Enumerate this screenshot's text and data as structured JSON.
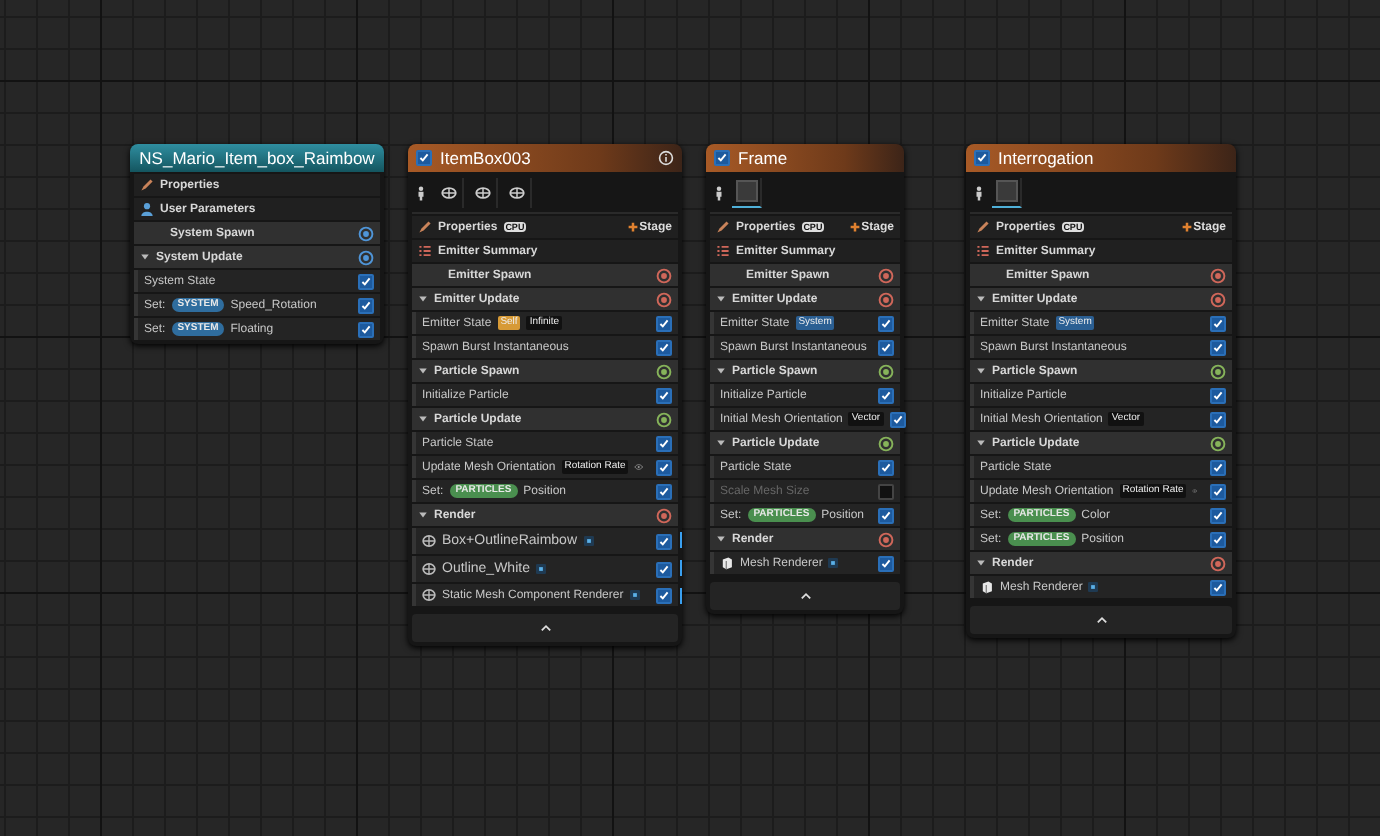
{
  "nodes": [
    {
      "kind": "system",
      "title": "NS_Mario_Item_box_Raimbow",
      "rows": [
        {
          "kind": "properties",
          "label": "Properties"
        },
        {
          "kind": "user_parameters",
          "label": "User Parameters"
        },
        {
          "kind": "group",
          "label": "System Spawn",
          "expandable": false,
          "color": "#4f95d8"
        },
        {
          "kind": "group",
          "label": "System Update",
          "expandable": true,
          "expanded": true,
          "color": "#4f95d8"
        },
        {
          "kind": "module",
          "checked": true,
          "parts": [
            {
              "kind": "text",
              "text": "System State"
            }
          ]
        },
        {
          "kind": "module",
          "checked": true,
          "parts": [
            {
              "kind": "text",
              "text": "Set:"
            },
            {
              "kind": "pill",
              "text": "SYSTEM",
              "color": "#2f6d9e"
            },
            {
              "kind": "text",
              "text": "Speed_Rotation"
            }
          ]
        },
        {
          "kind": "module",
          "checked": true,
          "parts": [
            {
              "kind": "text",
              "text": "Set:"
            },
            {
              "kind": "pill",
              "text": "SYSTEM",
              "color": "#2f6d9e"
            },
            {
              "kind": "text",
              "text": "Floating"
            }
          ]
        }
      ]
    },
    {
      "kind": "emitter",
      "title": "ItemBox003",
      "enabled": true,
      "info": true,
      "collapsible": true,
      "thumbnails": [
        {
          "selected": false
        },
        {
          "selected": false
        },
        {
          "selected": false
        }
      ],
      "rows": [
        {
          "kind": "properties",
          "label": "Properties",
          "sim_target": "CPU",
          "stage_button": "Stage"
        },
        {
          "kind": "summary",
          "label": "Emitter Summary"
        },
        {
          "kind": "group",
          "label": "Emitter Spawn",
          "expandable": false,
          "color": "#d0675a"
        },
        {
          "kind": "group",
          "label": "Emitter Update",
          "expandable": true,
          "expanded": true,
          "color": "#d0675a"
        },
        {
          "kind": "module",
          "checked": true,
          "parts": [
            {
              "kind": "text",
              "text": "Emitter State"
            },
            {
              "kind": "tag",
              "text": "Self",
              "color": "#d79a36"
            },
            {
              "kind": "tag",
              "text": "Infinite",
              "color": "#111111"
            }
          ]
        },
        {
          "kind": "module",
          "checked": true,
          "parts": [
            {
              "kind": "text",
              "text": "Spawn Burst Instantaneous"
            }
          ]
        },
        {
          "kind": "group",
          "label": "Particle Spawn",
          "expandable": true,
          "expanded": true,
          "color": "#86b35a"
        },
        {
          "kind": "module",
          "checked": true,
          "parts": [
            {
              "kind": "text",
              "text": "Initialize Particle"
            }
          ]
        },
        {
          "kind": "group",
          "label": "Particle Update",
          "expandable": true,
          "expanded": true,
          "color": "#86b35a"
        },
        {
          "kind": "module",
          "checked": true,
          "parts": [
            {
              "kind": "text",
              "text": "Particle State"
            }
          ]
        },
        {
          "kind": "module",
          "checked": true,
          "visibility_toggle": true,
          "parts": [
            {
              "kind": "text",
              "text": "Update Mesh Orientation"
            },
            {
              "kind": "tag",
              "text": "Rotation Rate",
              "color": "#111111"
            }
          ]
        },
        {
          "kind": "module",
          "checked": true,
          "parts": [
            {
              "kind": "text",
              "text": "Set:"
            },
            {
              "kind": "pill",
              "text": "PARTICLES",
              "color": "#4a8f4f"
            },
            {
              "kind": "text",
              "text": "Position"
            }
          ]
        },
        {
          "kind": "group",
          "label": "Render",
          "expandable": true,
          "expanded": true,
          "color": "#d0675a"
        },
        {
          "kind": "renderer",
          "label": "Box+OutlineRaimbow",
          "checked": true,
          "highlighted": true,
          "large": true
        },
        {
          "kind": "renderer",
          "label": "Outline_White",
          "checked": true,
          "highlighted": true,
          "large": true
        },
        {
          "kind": "renderer",
          "label": "Static Mesh Component Renderer",
          "checked": true,
          "highlighted": true,
          "large": false
        }
      ]
    },
    {
      "kind": "emitter",
      "title": "Frame",
      "enabled": true,
      "collapsible": true,
      "thumbnails": [
        {
          "selected": true
        }
      ],
      "rows": [
        {
          "kind": "properties",
          "label": "Properties",
          "sim_target": "CPU",
          "stage_button": "Stage"
        },
        {
          "kind": "summary",
          "label": "Emitter Summary"
        },
        {
          "kind": "group",
          "label": "Emitter Spawn",
          "expandable": false,
          "color": "#d0675a"
        },
        {
          "kind": "group",
          "label": "Emitter Update",
          "expandable": true,
          "expanded": true,
          "color": "#d0675a"
        },
        {
          "kind": "module",
          "checked": true,
          "parts": [
            {
              "kind": "text",
              "text": "Emitter State"
            },
            {
              "kind": "tag",
              "text": "System",
              "color": "#2b5f93"
            }
          ]
        },
        {
          "kind": "module",
          "checked": true,
          "parts": [
            {
              "kind": "text",
              "text": "Spawn Burst Instantaneous"
            }
          ]
        },
        {
          "kind": "group",
          "label": "Particle Spawn",
          "expandable": true,
          "expanded": true,
          "color": "#86b35a"
        },
        {
          "kind": "module",
          "checked": true,
          "parts": [
            {
              "kind": "text",
              "text": "Initialize Particle"
            }
          ]
        },
        {
          "kind": "module",
          "checked": true,
          "parts": [
            {
              "kind": "text",
              "text": "Initial Mesh Orientation"
            },
            {
              "kind": "tag",
              "text": "Vector",
              "color": "#111111"
            }
          ]
        },
        {
          "kind": "group",
          "label": "Particle Update",
          "expandable": true,
          "expanded": true,
          "color": "#86b35a"
        },
        {
          "kind": "module",
          "checked": true,
          "parts": [
            {
              "kind": "text",
              "text": "Particle State"
            }
          ]
        },
        {
          "kind": "module",
          "checked": false,
          "disabled": true,
          "parts": [
            {
              "kind": "text",
              "text": "Scale Mesh Size"
            }
          ]
        },
        {
          "kind": "module",
          "checked": true,
          "parts": [
            {
              "kind": "text",
              "text": "Set:"
            },
            {
              "kind": "pill",
              "text": "PARTICLES",
              "color": "#4a8f4f"
            },
            {
              "kind": "text",
              "text": "Position"
            }
          ]
        },
        {
          "kind": "group",
          "label": "Render",
          "expandable": true,
          "expanded": true,
          "color": "#d0675a"
        },
        {
          "kind": "mesh_renderer",
          "label": "Mesh Renderer",
          "checked": true
        }
      ]
    },
    {
      "kind": "emitter",
      "title": "Interrogation",
      "enabled": true,
      "collapsible": true,
      "thumbnails": [
        {
          "selected": true
        }
      ],
      "rows": [
        {
          "kind": "properties",
          "label": "Properties",
          "sim_target": "CPU",
          "stage_button": "Stage"
        },
        {
          "kind": "summary",
          "label": "Emitter Summary"
        },
        {
          "kind": "group",
          "label": "Emitter Spawn",
          "expandable": false,
          "color": "#d0675a"
        },
        {
          "kind": "group",
          "label": "Emitter Update",
          "expandable": true,
          "expanded": true,
          "color": "#d0675a"
        },
        {
          "kind": "module",
          "checked": true,
          "parts": [
            {
              "kind": "text",
              "text": "Emitter State"
            },
            {
              "kind": "tag",
              "text": "System",
              "color": "#2b5f93"
            }
          ]
        },
        {
          "kind": "module",
          "checked": true,
          "parts": [
            {
              "kind": "text",
              "text": "Spawn Burst Instantaneous"
            }
          ]
        },
        {
          "kind": "group",
          "label": "Particle Spawn",
          "expandable": true,
          "expanded": true,
          "color": "#86b35a"
        },
        {
          "kind": "module",
          "checked": true,
          "parts": [
            {
              "kind": "text",
              "text": "Initialize Particle"
            }
          ]
        },
        {
          "kind": "module",
          "checked": true,
          "parts": [
            {
              "kind": "text",
              "text": "Initial Mesh Orientation"
            },
            {
              "kind": "tag",
              "text": "Vector",
              "color": "#111111"
            }
          ]
        },
        {
          "kind": "group",
          "label": "Particle Update",
          "expandable": true,
          "expanded": true,
          "color": "#86b35a"
        },
        {
          "kind": "module",
          "checked": true,
          "parts": [
            {
              "kind": "text",
              "text": "Particle State"
            }
          ]
        },
        {
          "kind": "module",
          "checked": true,
          "visibility_toggle": true,
          "parts": [
            {
              "kind": "text",
              "text": "Update Mesh Orientation"
            },
            {
              "kind": "tag",
              "text": "Rotation Rate",
              "color": "#111111"
            }
          ]
        },
        {
          "kind": "module",
          "checked": true,
          "parts": [
            {
              "kind": "text",
              "text": "Set:"
            },
            {
              "kind": "pill",
              "text": "PARTICLES",
              "color": "#4a8f4f"
            },
            {
              "kind": "text",
              "text": "Color"
            }
          ]
        },
        {
          "kind": "module",
          "checked": true,
          "parts": [
            {
              "kind": "text",
              "text": "Set:"
            },
            {
              "kind": "pill",
              "text": "PARTICLES",
              "color": "#4a8f4f"
            },
            {
              "kind": "text",
              "text": "Position"
            }
          ]
        },
        {
          "kind": "group",
          "label": "Render",
          "expandable": true,
          "expanded": true,
          "color": "#d0675a"
        },
        {
          "kind": "mesh_renderer",
          "label": "Mesh Renderer",
          "checked": true
        }
      ]
    }
  ]
}
